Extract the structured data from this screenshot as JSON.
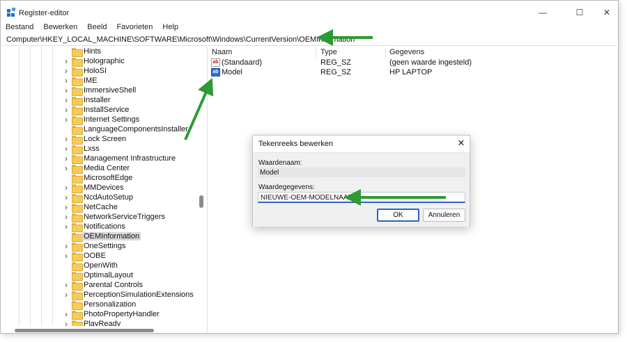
{
  "window": {
    "title": "Register-editor",
    "minimize_glyph": "—",
    "maximize_glyph": "☐",
    "close_glyph": "✕"
  },
  "menu": [
    "Bestand",
    "Bewerken",
    "Beeld",
    "Favorieten",
    "Help"
  ],
  "address": "Computer\\HKEY_LOCAL_MACHINE\\SOFTWARE\\Microsoft\\Windows\\CurrentVersion\\OEMInformation",
  "tree": {
    "items": [
      {
        "label": "Hints",
        "expandable": false
      },
      {
        "label": "Holographic",
        "expandable": true
      },
      {
        "label": "HoloSI",
        "expandable": true
      },
      {
        "label": "IME",
        "expandable": true
      },
      {
        "label": "ImmersiveShell",
        "expandable": true
      },
      {
        "label": "Installer",
        "expandable": true
      },
      {
        "label": "InstallService",
        "expandable": true
      },
      {
        "label": "Internet Settings",
        "expandable": true
      },
      {
        "label": "LanguageComponentsInstaller",
        "expandable": false
      },
      {
        "label": "Lock Screen",
        "expandable": true
      },
      {
        "label": "Lxss",
        "expandable": true
      },
      {
        "label": "Management Infrastructure",
        "expandable": true
      },
      {
        "label": "Media Center",
        "expandable": true
      },
      {
        "label": "MicrosoftEdge",
        "expandable": false
      },
      {
        "label": "MMDevices",
        "expandable": true
      },
      {
        "label": "NcdAutoSetup",
        "expandable": true
      },
      {
        "label": "NetCache",
        "expandable": true
      },
      {
        "label": "NetworkServiceTriggers",
        "expandable": true
      },
      {
        "label": "Notifications",
        "expandable": true
      },
      {
        "label": "OEMInformation",
        "expandable": false,
        "selected": true
      },
      {
        "label": "OneSettings",
        "expandable": true
      },
      {
        "label": "OOBE",
        "expandable": true
      },
      {
        "label": "OpenWith",
        "expandable": false
      },
      {
        "label": "OptimalLayout",
        "expandable": false
      },
      {
        "label": "Parental Controls",
        "expandable": true
      },
      {
        "label": "PerceptionSimulationExtensions",
        "expandable": true
      },
      {
        "label": "Personalization",
        "expandable": false
      },
      {
        "label": "PhotoPropertyHandler",
        "expandable": true
      },
      {
        "label": "PlayReady",
        "expandable": true
      }
    ]
  },
  "list": {
    "columns": {
      "name": "Naam",
      "type": "Type",
      "data": "Gegevens"
    },
    "rows": [
      {
        "icon": "ab",
        "name": "(Standaard)",
        "type": "REG_SZ",
        "data": "(geen waarde ingesteld)"
      },
      {
        "icon": "ab",
        "name": "Model",
        "type": "REG_SZ",
        "data": "HP LAPTOP"
      }
    ]
  },
  "dialog": {
    "title": "Tekenreeks bewerken",
    "close_glyph": "✕",
    "value_name_label": "Waardenaam:",
    "value_name": "Model",
    "value_data_label": "Waardegegevens:",
    "value_data": "NIEUWE-OEM-MODELNAAM",
    "ok_label": "OK",
    "cancel_label": "Annuleren"
  },
  "colors": {
    "arrow": "#2e9a34",
    "folder": "#f7cc56",
    "accent": "#2b62c6"
  }
}
